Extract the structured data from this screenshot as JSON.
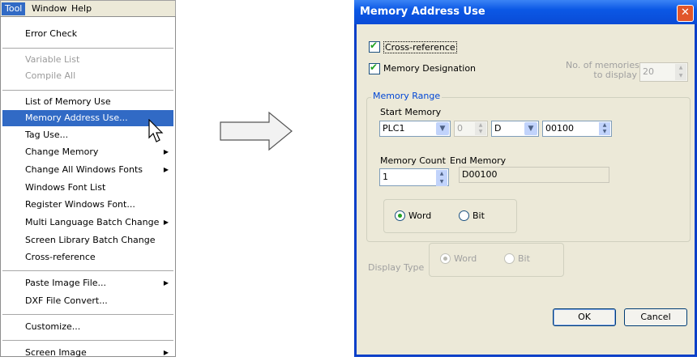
{
  "menubar": {
    "items": [
      "Tool",
      "Window",
      "Help"
    ]
  },
  "menu": {
    "items": [
      {
        "label": "Error Check"
      },
      {
        "label": "Variable List"
      },
      {
        "label": "Compile All"
      },
      {
        "label": "List of Memory Use"
      },
      {
        "label": "Memory Address Use..."
      },
      {
        "label": "Tag Use..."
      },
      {
        "label": "Change Memory"
      },
      {
        "label": "Change All Windows Fonts"
      },
      {
        "label": "Windows Font List"
      },
      {
        "label": "Register Windows Font..."
      },
      {
        "label": "Multi Language Batch Change"
      },
      {
        "label": "Screen Library Batch Change"
      },
      {
        "label": "Cross-reference"
      },
      {
        "label": "Paste Image File..."
      },
      {
        "label": "DXF File Convert..."
      },
      {
        "label": "Customize..."
      },
      {
        "label": "Screen Image"
      }
    ]
  },
  "dialog": {
    "title": "Memory Address Use",
    "close": "✕",
    "cross_reference": "Cross-reference",
    "memory_designation": "Memory Designation",
    "no_memories_label_1": "No. of memories",
    "no_memories_label_2": "to display",
    "no_memories_value": "20",
    "memory_range_title": "Memory Range",
    "start_memory_label": "Start Memory",
    "plc_value": "PLC1",
    "station_value": "0",
    "device_value": "D",
    "address_value": "00100",
    "memory_count_label": "Memory Count",
    "memory_count_value": "1",
    "end_memory_label": "End Memory",
    "end_memory_value": "D00100",
    "word_label": "Word",
    "bit_label": "Bit",
    "display_type_label": "Display Type",
    "display_word_label": "Word",
    "display_bit_label": "Bit",
    "ok_label": "OK",
    "cancel_label": "Cancel"
  },
  "colors": {
    "highlight": "#316ac5",
    "titlebar": "#0b58e5",
    "dialog_bg": "#ece9d8"
  }
}
